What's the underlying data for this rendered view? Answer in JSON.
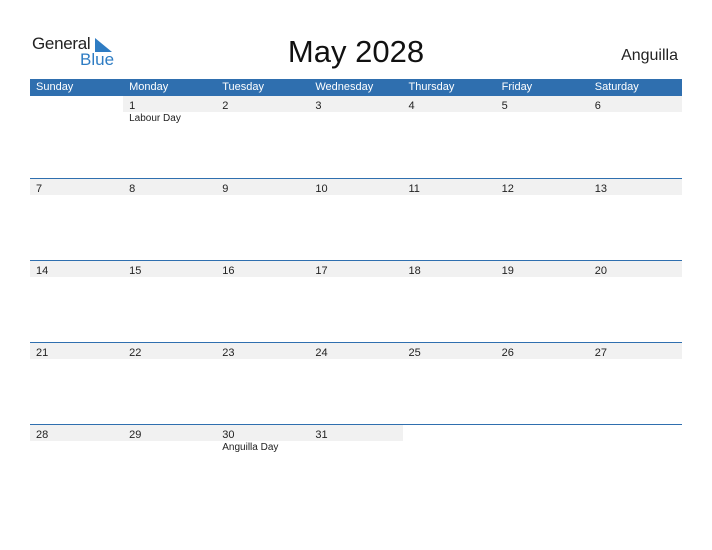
{
  "logo": {
    "line1": "General",
    "line2": "Blue"
  },
  "title": "May 2028",
  "country": "Anguilla",
  "colors": {
    "header": "#2f6faf",
    "accent": "#2e7cc3",
    "date_strip": "#f1f1f1"
  },
  "days": [
    "Sunday",
    "Monday",
    "Tuesday",
    "Wednesday",
    "Thursday",
    "Friday",
    "Saturday"
  ],
  "weeks": [
    [
      {
        "d": ""
      },
      {
        "d": "1",
        "h": "Labour Day"
      },
      {
        "d": "2"
      },
      {
        "d": "3"
      },
      {
        "d": "4"
      },
      {
        "d": "5"
      },
      {
        "d": "6"
      }
    ],
    [
      {
        "d": "7"
      },
      {
        "d": "8"
      },
      {
        "d": "9"
      },
      {
        "d": "10"
      },
      {
        "d": "11"
      },
      {
        "d": "12"
      },
      {
        "d": "13"
      }
    ],
    [
      {
        "d": "14"
      },
      {
        "d": "15"
      },
      {
        "d": "16"
      },
      {
        "d": "17"
      },
      {
        "d": "18"
      },
      {
        "d": "19"
      },
      {
        "d": "20"
      }
    ],
    [
      {
        "d": "21"
      },
      {
        "d": "22"
      },
      {
        "d": "23"
      },
      {
        "d": "24"
      },
      {
        "d": "25"
      },
      {
        "d": "26"
      },
      {
        "d": "27"
      }
    ],
    [
      {
        "d": "28"
      },
      {
        "d": "29"
      },
      {
        "d": "30",
        "h": "Anguilla Day"
      },
      {
        "d": "31"
      },
      {
        "d": ""
      },
      {
        "d": ""
      },
      {
        "d": ""
      }
    ]
  ]
}
